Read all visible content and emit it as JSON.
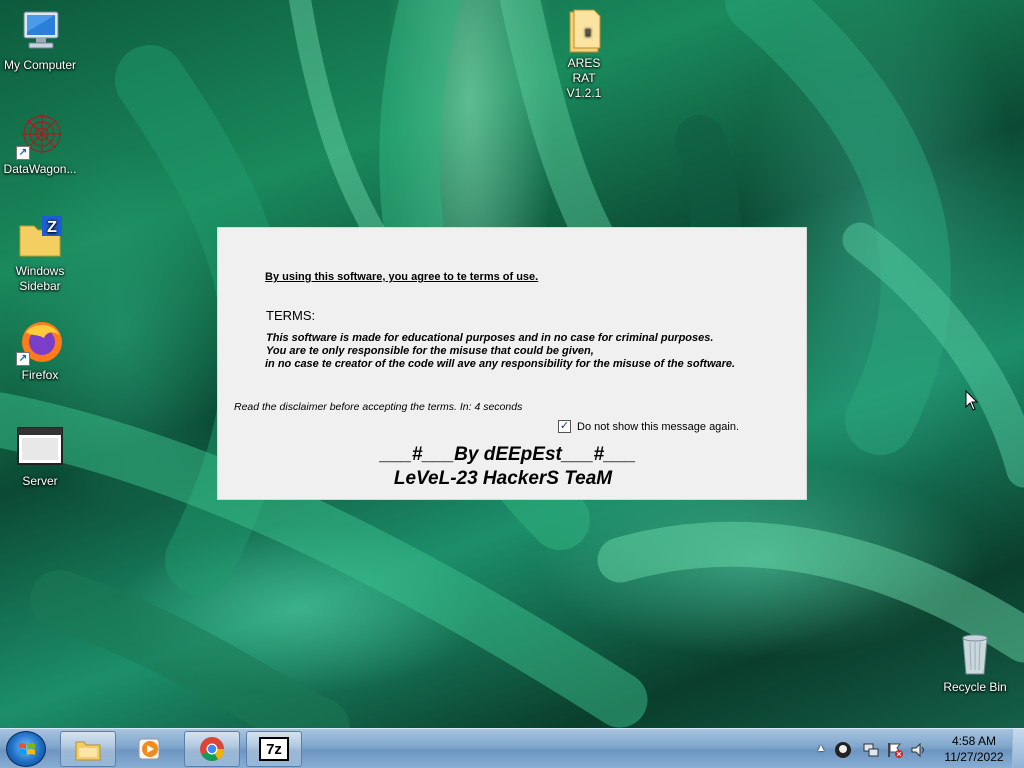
{
  "desktop": {
    "icons": [
      {
        "label": "My Computer",
        "icon": "computer-icon"
      },
      {
        "label": "DataWagon...",
        "icon": "spiderweb-icon",
        "shortcut": true
      },
      {
        "label": "Windows Sidebar",
        "icon": "folder-zip-icon"
      },
      {
        "label": "Firefox",
        "icon": "firefox-icon",
        "shortcut": true
      },
      {
        "label": "Server",
        "icon": "window-icon"
      },
      {
        "label": "ARES RAT V1.2.1",
        "icon": "folder-icon"
      },
      {
        "label": "Recycle Bin",
        "icon": "recycle-bin-icon"
      }
    ]
  },
  "dialog": {
    "agree_text": "By using this software, you agree to te terms of use.",
    "terms_title": "TERMS:",
    "terms_lines": [
      "This software is made for educational purposes and in no case for criminal purposes.",
      "You are te only responsible for the misuse that could be given,",
      "in no case te creator of the code will ave any responsibility for the misuse of the software."
    ],
    "disclaimer": "Read the disclaimer before accepting the terms. In: 4 seconds",
    "dont_show_label": "Do not show this message again.",
    "dont_show_checked": true,
    "signature_line1": "___#___By dEEpEst___#___",
    "signature_line2": "LeVeL-23 HackerS TeaM"
  },
  "taskbar": {
    "apps": [
      {
        "name": "Windows Explorer",
        "icon": "explorer-icon"
      },
      {
        "name": "Media Player",
        "icon": "media-player-icon"
      },
      {
        "name": "Google Chrome",
        "icon": "chrome-icon"
      },
      {
        "name": "7-Zip",
        "icon": "7zip-icon",
        "text": "7z"
      }
    ],
    "clock_time": "4:58 AM",
    "clock_date": "11/27/2022"
  },
  "colors": {
    "dialog_bg": "#f0f0f0",
    "taskbar": "#7fa6cc",
    "wallpaper_green": "#1a8a5c"
  }
}
